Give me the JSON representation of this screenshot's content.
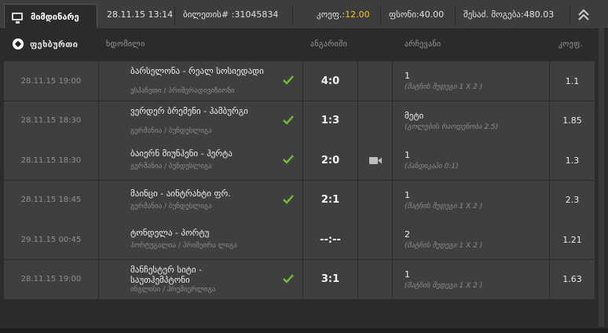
{
  "header": {
    "tab_label": "მიმდინარე",
    "datetime": "28.11.15 13:14",
    "ticket_label": "ბილეთის# : ",
    "ticket_number": "31045834",
    "coef_label": "კოეფ.: ",
    "coef_value": "12.00",
    "amount_label": "ფსონი: ",
    "amount_value": "40.00",
    "win_label": "შესაძ. მოგება: ",
    "win_value": "480.03"
  },
  "table": {
    "sport_label": "ფეხბურთი",
    "col_event": "ხდომილი",
    "col_score": "ანგარიში",
    "col_pick": "არჩევანი",
    "col_odds": "კოეფ."
  },
  "rows": [
    {
      "date": "28.11.15 19:00",
      "teams": "ბარსელონა - რეალ სოსიედადი",
      "league": "ესპანეთი / პრიმერადივიზიონი",
      "won": true,
      "score": "4:0",
      "video": false,
      "pick": "1",
      "pick_desc": "(მატჩის შედეგი 1 X 2 )",
      "odds": "1.1"
    },
    {
      "date": "28.11.15 18:30",
      "teams": "ვერდერ ბრემენი - ჰამბურგი",
      "league": "გერმანია / ბუნდესლიგა",
      "won": true,
      "score": "1:3",
      "video": false,
      "pick": "მეტი",
      "pick_desc": "(გოლების რაოდენობა 2.5)",
      "odds": "1.85"
    },
    {
      "date": "28.11.15 18:30",
      "teams": "ბაიერნ მიუნჰენი - ჰერტა",
      "league": "გერმანია / ბუნდესლიგა",
      "won": true,
      "score": "2:0",
      "video": true,
      "pick": "1",
      "pick_desc": "(ჰანდიკაპი 0:1)",
      "odds": "1.3"
    },
    {
      "date": "28.11.15 18:45",
      "teams": "მაინცი - აინტრახტი ფრ.",
      "league": "გერმანია / ბუნდესლიგა",
      "won": true,
      "score": "2:1",
      "video": false,
      "pick": "1",
      "pick_desc": "(მატჩის შედეგი 1 X 2 )",
      "odds": "2.3"
    },
    {
      "date": "29.11.15 00:45",
      "teams": "ტონდელა - პორტუ",
      "league": "პორტუგალია / პრიმეირა ლიგა",
      "won": false,
      "score": "--:--",
      "video": false,
      "pick": "2",
      "pick_desc": "(მატჩის შედეგი 1 X 2 )",
      "odds": "1.21"
    },
    {
      "date": "28.11.15 19:00",
      "teams": "მანჩესტერ სიტი - საუთჰემპტონი",
      "league": "ინგლისი / პრემიერლიგა",
      "won": true,
      "score": "3:1",
      "video": false,
      "pick": "1",
      "pick_desc": "(მატჩის შედეგი 1 X 2 )",
      "odds": "1.63"
    }
  ],
  "colors": {
    "accent_yellow": "#f3c51a",
    "check_green": "#6fbf3a"
  }
}
